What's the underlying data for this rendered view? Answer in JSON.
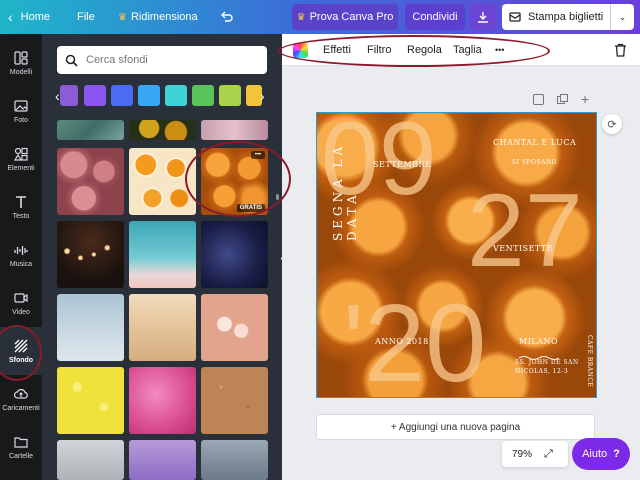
{
  "topbar": {
    "home": "Home",
    "file": "File",
    "resize": "Ridimensiona",
    "pro": "Prova Canva Pro",
    "share": "Condividi",
    "print": "Stampa biglietti"
  },
  "rail": [
    {
      "label": "Modelli",
      "icon": "templates-icon"
    },
    {
      "label": "Foto",
      "icon": "photo-icon"
    },
    {
      "label": "Elementi",
      "icon": "elements-icon"
    },
    {
      "label": "Testo",
      "icon": "text-icon"
    },
    {
      "label": "Musica",
      "icon": "music-icon"
    },
    {
      "label": "Video",
      "icon": "video-icon"
    },
    {
      "label": "Sfondo",
      "icon": "background-icon"
    },
    {
      "label": "Caricamenti",
      "icon": "upload-icon"
    },
    {
      "label": "Cartelle",
      "icon": "folder-icon"
    }
  ],
  "search": {
    "placeholder": "Cerca sfondi"
  },
  "swatches": [
    "#8e5bd6",
    "#8a55f0",
    "#4a6cf2",
    "#38a7f5",
    "#3fd0d8",
    "#58c45a",
    "#a9d34a",
    "#f3c43a"
  ],
  "gratis_label": "GRATIS",
  "ctx": {
    "effects": "Effetti",
    "filter": "Filtro",
    "adjust": "Regola",
    "crop": "Taglia",
    "more": "•••"
  },
  "design": {
    "n1": "09",
    "n2": "27",
    "n3": "'20",
    "month": "SETTEMBRE",
    "names": "CHANTAL E LUCA",
    "marry": "SI SPOSANO",
    "save": "SEGNA LA DATA",
    "day": "VENTISETTE",
    "year": "ANNO 2018",
    "city": "MILANO",
    "addr1": "SS. JOHN DE SAN",
    "addr2": "NICOLAS, 12-3",
    "side": "CAFE BRANCE"
  },
  "add_page": "+ Aggiungi una nuova pagina",
  "zoom": "79%",
  "help": "Aiuto",
  "help_q": "?"
}
